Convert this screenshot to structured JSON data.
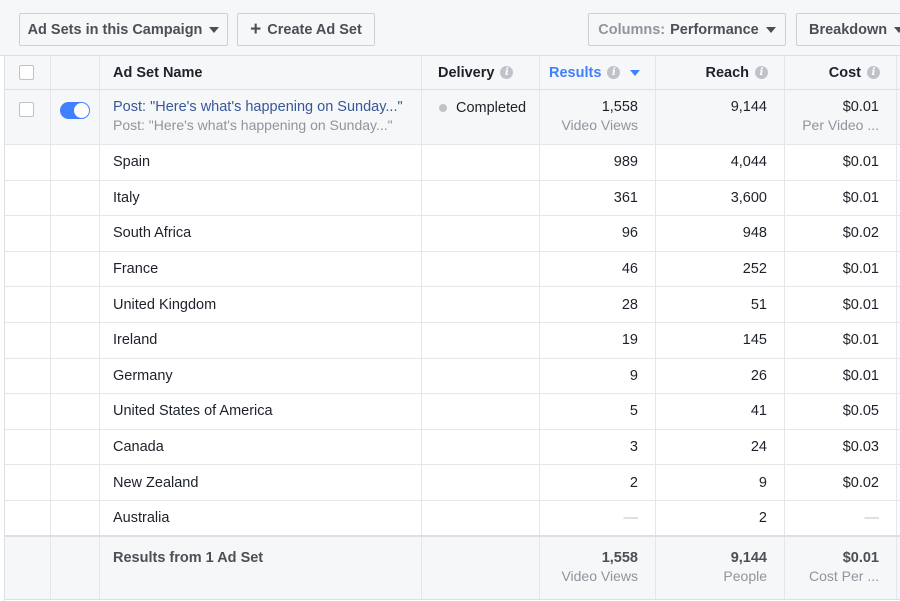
{
  "toolbar": {
    "adsets_label": "Ad Sets in this Campaign",
    "create_label": "Create Ad Set",
    "columns_prefix": "Columns:",
    "columns_value": "Performance",
    "breakdown_label": "Breakdown"
  },
  "header": {
    "name": "Ad Set Name",
    "delivery": "Delivery",
    "results": "Results",
    "reach": "Reach",
    "cost": "Cost"
  },
  "adset": {
    "title": "Post: \"Here's what's happening on Sunday...\"",
    "subtitle": "Post: \"Here's what's happening on Sunday...\"",
    "delivery": "Completed",
    "results": "1,558",
    "results_sub": "Video Views",
    "reach": "9,144",
    "cost": "$0.01",
    "cost_sub": "Per Video ..."
  },
  "breakdown_rows": [
    {
      "name": "Spain",
      "results": "989",
      "reach": "4,044",
      "cost": "$0.01"
    },
    {
      "name": "Italy",
      "results": "361",
      "reach": "3,600",
      "cost": "$0.01"
    },
    {
      "name": "South Africa",
      "results": "96",
      "reach": "948",
      "cost": "$0.02"
    },
    {
      "name": "France",
      "results": "46",
      "reach": "252",
      "cost": "$0.01"
    },
    {
      "name": "United Kingdom",
      "results": "28",
      "reach": "51",
      "cost": "$0.01"
    },
    {
      "name": "Ireland",
      "results": "19",
      "reach": "145",
      "cost": "$0.01"
    },
    {
      "name": "Germany",
      "results": "9",
      "reach": "26",
      "cost": "$0.01"
    },
    {
      "name": "United States of America",
      "results": "5",
      "reach": "41",
      "cost": "$0.05"
    },
    {
      "name": "Canada",
      "results": "3",
      "reach": "24",
      "cost": "$0.03"
    },
    {
      "name": "New Zealand",
      "results": "2",
      "reach": "9",
      "cost": "$0.02"
    },
    {
      "name": "Australia",
      "results": "—",
      "reach": "2",
      "cost": "—"
    }
  ],
  "footer": {
    "label": "Results from 1 Ad Set",
    "results": "1,558",
    "results_sub": "Video Views",
    "reach": "9,144",
    "reach_sub": "People",
    "cost": "$0.01",
    "cost_sub": "Cost Per ..."
  },
  "colors": {
    "accent": "#4080ff",
    "link": "#365899",
    "muted": "#90949c"
  }
}
